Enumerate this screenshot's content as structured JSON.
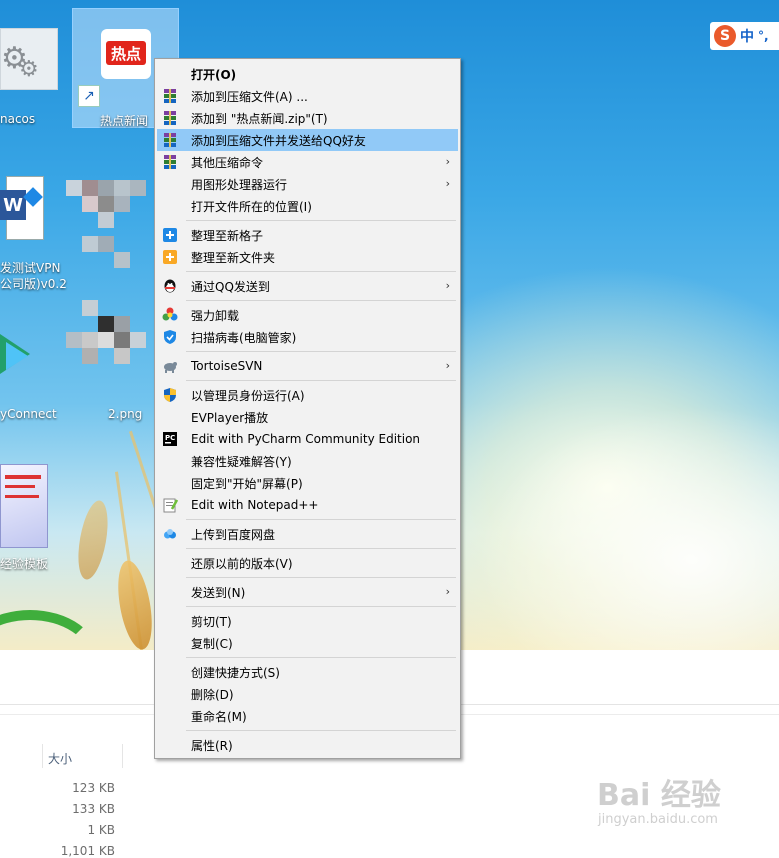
{
  "desktop": {
    "icons": [
      {
        "label": "nacos"
      },
      {
        "label": "热点新闻",
        "tile_text": "热点"
      },
      {
        "label": "发测试VPN"
      },
      {
        "label": "公司版)v0.2"
      },
      {
        "label": "yConnect"
      },
      {
        "label": "2.png"
      },
      {
        "label": "经验模板"
      }
    ]
  },
  "ime": {
    "label": "中",
    "extra": "°,"
  },
  "context_menu": {
    "items": [
      {
        "label": "打开(O)",
        "icon": "none",
        "bold": true
      },
      {
        "label": "添加到压缩文件(A) ...",
        "icon": "winrar-icon"
      },
      {
        "label": "添加到 \"热点新闻.zip\"(T)",
        "icon": "winrar-icon"
      },
      {
        "label": "添加到压缩文件并发送给QQ好友",
        "icon": "winrar-icon",
        "highlighted": true
      },
      {
        "label": "其他压缩命令",
        "icon": "winrar-icon",
        "submenu": true
      },
      {
        "label": "用图形处理器运行",
        "icon": "none",
        "submenu": true
      },
      {
        "label": "打开文件所在的位置(I)",
        "icon": "none"
      },
      {
        "label": "整理至新格子",
        "icon": "fence-plus-icon"
      },
      {
        "label": "整理至新文件夹",
        "icon": "fence-folder-icon"
      },
      {
        "label": "通过QQ发送到",
        "icon": "qq-icon",
        "submenu": true
      },
      {
        "label": "强力卸载",
        "icon": "uninstall-icon"
      },
      {
        "label": "扫描病毒(电脑管家)",
        "icon": "shield-icon"
      },
      {
        "label": "TortoiseSVN",
        "icon": "tortoise-icon",
        "submenu": true
      },
      {
        "label": "以管理员身份运行(A)",
        "icon": "uac-shield-icon"
      },
      {
        "label": "EVPlayer播放",
        "icon": "none"
      },
      {
        "label": "Edit with PyCharm Community Edition",
        "icon": "pycharm-icon"
      },
      {
        "label": "兼容性疑难解答(Y)",
        "icon": "none"
      },
      {
        "label": "固定到\"开始\"屏幕(P)",
        "icon": "none"
      },
      {
        "label": "Edit with Notepad++",
        "icon": "notepad-icon"
      },
      {
        "label": "上传到百度网盘",
        "icon": "baidu-cloud-icon"
      },
      {
        "label": "还原以前的版本(V)",
        "icon": "none"
      },
      {
        "label": "发送到(N)",
        "icon": "none",
        "submenu": true
      },
      {
        "label": "剪切(T)",
        "icon": "none"
      },
      {
        "label": "复制(C)",
        "icon": "none"
      },
      {
        "label": "创建快捷方式(S)",
        "icon": "none"
      },
      {
        "label": "删除(D)",
        "icon": "none"
      },
      {
        "label": "重命名(M)",
        "icon": "none"
      },
      {
        "label": "属性(R)",
        "icon": "none"
      }
    ],
    "submenu_arrow": "›"
  },
  "explorer": {
    "size_header": "大小",
    "sizes": [
      "123 KB",
      "133 KB",
      "1 KB",
      "1,101 KB"
    ]
  },
  "watermark": {
    "main": "Bai 经验",
    "sub": "jingyan.baidu.com"
  },
  "colors": {
    "highlight": "#91c9f7",
    "menu_bg": "#f2f2f2",
    "desktop_sky": "#3aa7e6"
  }
}
